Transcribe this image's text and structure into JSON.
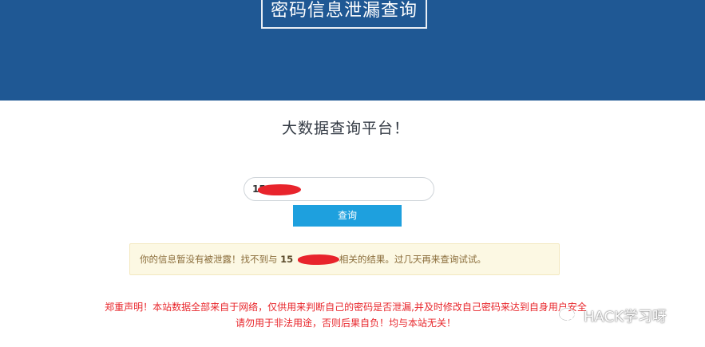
{
  "header": {
    "site_title": "密码信息泄漏查询",
    "background_color": "#1f5894"
  },
  "main": {
    "subtitle": "大数据查询平台！",
    "search": {
      "value_visible": "15"
    },
    "query_button_label": "查询",
    "alert": {
      "prefix": "你的信息暂没有被泄露！找不到与 ",
      "phone_visible": "15",
      "suffix": " 相关的结果。过几天再来查询试试。"
    },
    "disclaimer": {
      "line1": "郑重声明！本站数据全部来自于网络，仅供用来判断自己的密码是否泄漏,并及时修改自己密码来达到自身用户安全",
      "line2": "请勿用于非法用途，否则后果自负！均与本站无关！"
    }
  },
  "watermark": {
    "icon": "wechat-icon",
    "text": "HACK学习呀"
  },
  "colors": {
    "button": "#1ea0de",
    "alert_bg": "#fcf8e3",
    "alert_text": "#8a6d3b",
    "disclaimer_text": "#e8262b",
    "redaction": "#e8242c"
  }
}
